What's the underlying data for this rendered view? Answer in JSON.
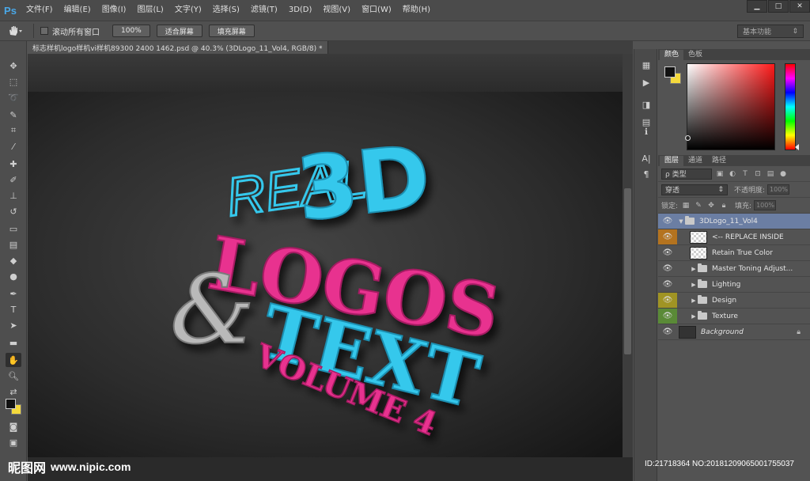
{
  "app": {
    "logo": "Ps"
  },
  "menu": [
    "文件(F)",
    "编辑(E)",
    "图像(I)",
    "图层(L)",
    "文字(Y)",
    "选择(S)",
    "滤镜(T)",
    "3D(D)",
    "视图(V)",
    "窗口(W)",
    "帮助(H)"
  ],
  "window_controls": {
    "minimize": "▁",
    "restore": "□",
    "close": "✕"
  },
  "options": {
    "scroll_all_label": "滚动所有窗口",
    "zoom_100": "100%",
    "fit_screen": "适合屏幕",
    "fill_screen": "填充屏幕",
    "workspace": "基本功能"
  },
  "document": {
    "tab_title": "标志样机logo样机vi样机89300 2400 1462.psd @ 40.3% (3DLogo_11_Vol4, RGB/8) *",
    "close": "×"
  },
  "artwork": {
    "line1": "REAL",
    "line1b": "3D",
    "line2": "LOGOS",
    "amp": "&",
    "line3": "TEXT",
    "line4": "VOLUME 4",
    "colors": {
      "cyan": "#35c8ec",
      "pink": "#e8308f",
      "silver": "#b9b9b9"
    }
  },
  "panels": {
    "color_tabs": [
      "颜色",
      "色板"
    ],
    "layer_tabs": [
      "图层",
      "通道",
      "路径"
    ],
    "filter_label": "ρ 类型",
    "blend_mode": "穿透",
    "opacity_label": "不透明度:",
    "opacity_value": "100%",
    "lock_label": "锁定:",
    "fill_label": "填充:",
    "fill_value": "100%",
    "swatches": {
      "foreground": "#111111",
      "background": "#f4d93c"
    }
  },
  "layers": [
    {
      "name": "3DLogo_11_Vol4",
      "type": "group-open",
      "selected": true,
      "eye": "none"
    },
    {
      "name": "<-- REPLACE INSIDE",
      "type": "smart",
      "eye": "orange"
    },
    {
      "name": "Retain True Color",
      "type": "smart",
      "eye": "none"
    },
    {
      "name": "Master Toning Adjust...",
      "type": "group",
      "eye": "none"
    },
    {
      "name": "Lighting",
      "type": "group",
      "eye": "none"
    },
    {
      "name": "Design",
      "type": "group",
      "eye": "yellow"
    },
    {
      "name": "Texture",
      "type": "group",
      "eye": "green"
    },
    {
      "name": "Background",
      "type": "background",
      "eye": "none"
    }
  ],
  "watermark": {
    "logo": "昵图网",
    "url": "www.nipic.com",
    "id": "ID:21718364 NO:20181209065001755037"
  }
}
